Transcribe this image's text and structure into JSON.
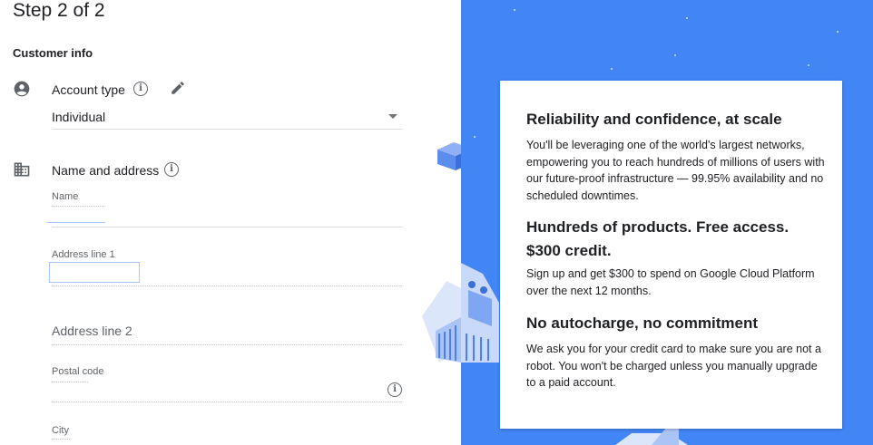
{
  "header": {
    "step": "Step 2 of 2",
    "section": "Customer info"
  },
  "account": {
    "label": "Account type",
    "value": "Individual",
    "icons": [
      "account-circle-icon",
      "info-icon",
      "pencil-icon",
      "dropdown-arrow-icon"
    ]
  },
  "address": {
    "label": "Name and address",
    "name_label": "Name",
    "line1_label": "Address line 1",
    "line2_placeholder": "Address line 2",
    "postal_label": "Postal code",
    "city_label": "City",
    "icons": [
      "building-icon",
      "info-icon"
    ]
  },
  "promo": {
    "heading1": "Reliability and confidence, at scale",
    "body1": "You'll be leveraging one of the world's largest networks, empowering you to reach hundreds of millions of users with our future-proof infrastructure — 99.95% availability and no scheduled downtimes.",
    "heading2": "Hundreds of products. Free access. $300 credit.",
    "body2": "Sign up and get $300 to spend on Google Cloud Platform over the next 12 months.",
    "heading3": "No autocharge, no commitment",
    "body3": "We ask you for your credit card to make sure you are not a robot. You won't be charged unless you manually upgrade to a paid account."
  },
  "colors": {
    "panel_blue": "#4285f4",
    "text": "#202124",
    "secondary": "#5f6368"
  }
}
